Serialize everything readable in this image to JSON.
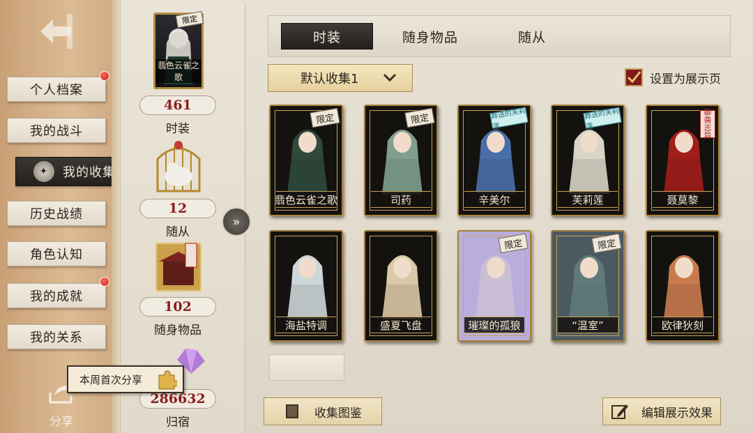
{
  "left_menu": {
    "items": [
      {
        "label": "个人档案",
        "dot": true
      },
      {
        "label": "我的战斗",
        "dot": false
      },
      {
        "label": "我的收集",
        "dot": false,
        "active": true
      },
      {
        "label": "历史战绩",
        "dot": false
      },
      {
        "label": "角色认知",
        "dot": false
      },
      {
        "label": "我的成就",
        "dot": true
      },
      {
        "label": "我的关系",
        "dot": false
      }
    ],
    "share_label": "分享",
    "share_bubble": "本周首次分享"
  },
  "stats": {
    "top_thumb_tag": "限定",
    "top_thumb_label": "翡色云雀之歌",
    "costumes": {
      "count": "461",
      "label": "时装"
    },
    "pets": {
      "count": "12",
      "label": "随从"
    },
    "items": {
      "count": "102",
      "label": "随身物品"
    },
    "home": {
      "count": "286632",
      "label": "归宿"
    }
  },
  "tabs": [
    {
      "label": "时装",
      "active": true
    },
    {
      "label": "随身物品",
      "active": false
    },
    {
      "label": "随从",
      "active": false
    }
  ],
  "dropdown": {
    "value": "默认收集1"
  },
  "showcase_toggle": {
    "label": "设置为展示页",
    "checked": true
  },
  "cards": [
    {
      "name": "翡色云雀之歌",
      "tag": "限定",
      "tag_style": "plain",
      "color": "#2f4a3c"
    },
    {
      "name": "司药",
      "tag": "限定",
      "tag_style": "plain",
      "color": "#7fa08e"
    },
    {
      "name": "辛美尔",
      "tag": "葬送的芙莉莲",
      "tag_style": "blue",
      "color": "#4a6fa8"
    },
    {
      "name": "芙莉莲",
      "tag": "葬送的芙莉莲",
      "tag_style": "blue",
      "color": "#d8d4c6"
    },
    {
      "name": "聂莫黎",
      "tag": "聊斋志异",
      "tag_style": "red",
      "color": "#a21e1a"
    },
    {
      "name": "海盐特调",
      "tag": "",
      "tag_style": "none",
      "color": "#cdd6d8"
    },
    {
      "name": "盛夏飞盘",
      "tag": "",
      "tag_style": "none",
      "color": "#d9c9a6"
    },
    {
      "name": "璀璨的孤狼",
      "tag": "限定",
      "tag_style": "plain",
      "color": "#cbbfd6"
    },
    {
      "name": "“温室”",
      "tag": "限定",
      "tag_style": "plain",
      "color": "#5f7a79"
    },
    {
      "name": "欧律狄刻",
      "tag": "",
      "tag_style": "none",
      "color": "#c87a4c"
    }
  ],
  "bottom": {
    "collection_label": "收集图鉴",
    "edit_label": "编辑展示效果"
  }
}
